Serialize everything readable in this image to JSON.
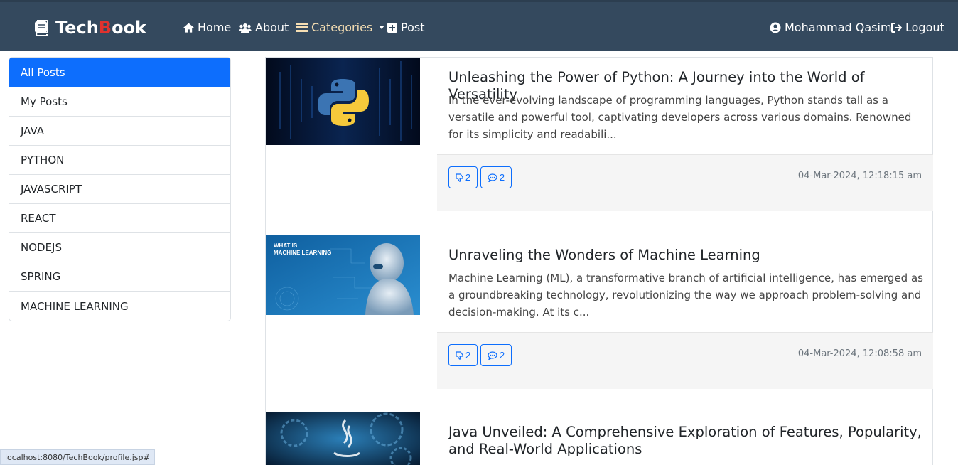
{
  "navbar": {
    "brand_prefix": "Tech",
    "brand_b": "B",
    "brand_suffix": "ook",
    "home": "Home",
    "about": "About",
    "categories": "Categories",
    "post": "Post",
    "user": "Mohammad Qasim",
    "logout": "Logout"
  },
  "sidebar": {
    "items": [
      "All Posts",
      "My Posts",
      "JAVA",
      "PYTHON",
      "JAVASCRIPT",
      "REACT",
      "NODEJS",
      "SPRING",
      "MACHINE LEARNING"
    ]
  },
  "posts": [
    {
      "title": "Unleashing the Power of Python: A Journey into the World of Versatility",
      "excerpt": "In the ever-evolving landscape of programming languages, Python stands tall as a versatile and powerful tool, captivating developers across various domains. Renowned for its simplicity and readabili...",
      "likes": "2",
      "comments": "2",
      "date": "04-Mar-2024, 12:18:15 am"
    },
    {
      "title": "Unraveling the Wonders of Machine Learning",
      "excerpt": "Machine Learning (ML), a transformative branch of artificial intelligence, has emerged as a groundbreaking technology, revolutionizing the way we approach problem-solving and decision-making. At its c...",
      "likes": "2",
      "comments": "2",
      "date": "04-Mar-2024, 12:08:58 am",
      "image_text_1": "WHAT IS",
      "image_text_2": "MACHINE LEARNING"
    },
    {
      "title": "Java Unveiled: A Comprehensive Exploration of Features, Popularity, and Real-World Applications"
    }
  ],
  "status_bar": {
    "url": "localhost:8080/TechBook/profile.jsp#"
  }
}
